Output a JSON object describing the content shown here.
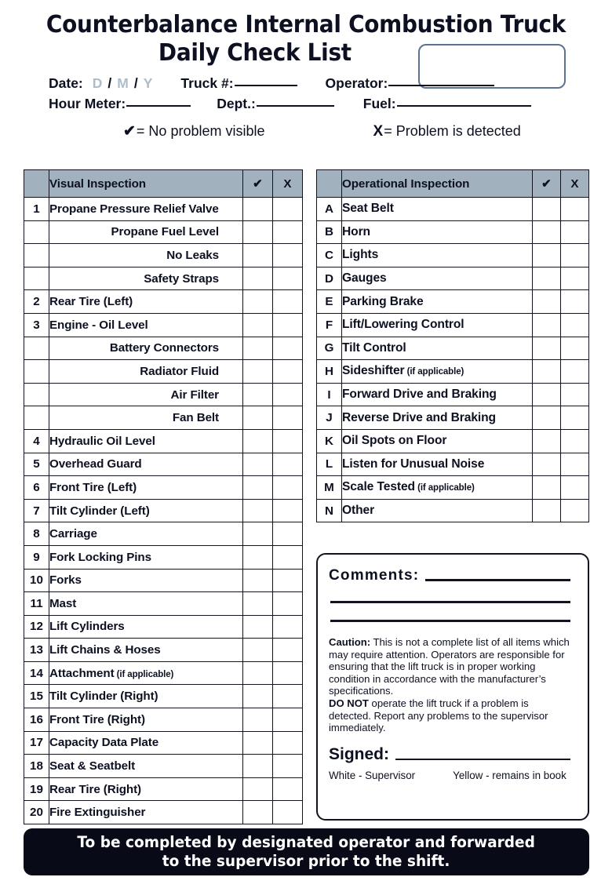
{
  "title": {
    "line1": "Counterbalance Internal Combustion Truck",
    "line2": "Daily Check List"
  },
  "header": {
    "date_label": "Date:",
    "date_day": "D",
    "date_month": "M",
    "date_year": "Y",
    "slash": "/",
    "truck_label": "Truck #:",
    "operator_label": "Operator:",
    "hour_meter_label": "Hour Meter:",
    "dept_label": "Dept.:",
    "fuel_label": "Fuel:"
  },
  "legend": {
    "check_mark": "✔",
    "check_text": "= No problem visible",
    "x_mark": "X",
    "x_text": "= Problem is detected"
  },
  "visual": {
    "header": {
      "title": "Visual Inspection",
      "check": "✔",
      "x": "X"
    },
    "rows": [
      {
        "num": "1",
        "label": "Propane Pressure Relief Valve",
        "sub": false
      },
      {
        "num": "",
        "label": "Propane Fuel Level",
        "sub": true
      },
      {
        "num": "",
        "label": "No Leaks",
        "sub": true
      },
      {
        "num": "",
        "label": "Safety Straps",
        "sub": true
      },
      {
        "num": "2",
        "label": "Rear Tire (Left)",
        "sub": false
      },
      {
        "num": "3",
        "label": "Engine - Oil Level",
        "sub": false
      },
      {
        "num": "",
        "label": "Battery Connectors",
        "sub": true
      },
      {
        "num": "",
        "label": "Radiator Fluid",
        "sub": true
      },
      {
        "num": "",
        "label": "Air Filter",
        "sub": true
      },
      {
        "num": "",
        "label": "Fan Belt",
        "sub": true
      },
      {
        "num": "4",
        "label": "Hydraulic Oil Level",
        "sub": false
      },
      {
        "num": "5",
        "label": "Overhead Guard",
        "sub": false
      },
      {
        "num": "6",
        "label": "Front Tire (Left)",
        "sub": false
      },
      {
        "num": "7",
        "label": "Tilt Cylinder (Left)",
        "sub": false
      },
      {
        "num": "8",
        "label": "Carriage",
        "sub": false
      },
      {
        "num": "9",
        "label": "Fork Locking Pins",
        "sub": false
      },
      {
        "num": "10",
        "label": "Forks",
        "sub": false
      },
      {
        "num": "11",
        "label": "Mast",
        "sub": false
      },
      {
        "num": "12",
        "label": "Lift Cylinders",
        "sub": false
      },
      {
        "num": "13",
        "label": "Lift Chains & Hoses",
        "sub": false
      },
      {
        "num": "14",
        "label": "Attachment",
        "note": "(if applicable)",
        "sub": false
      },
      {
        "num": "15",
        "label": "Tilt Cylinder (Right)",
        "sub": false
      },
      {
        "num": "16",
        "label": "Front Tire (Right)",
        "sub": false
      },
      {
        "num": "17",
        "label": "Capacity Data Plate",
        "sub": false
      },
      {
        "num": "18",
        "label": "Seat & Seatbelt",
        "sub": false
      },
      {
        "num": "19",
        "label": "Rear Tire (Right)",
        "sub": false
      },
      {
        "num": "20",
        "label": "Fire Extinguisher",
        "sub": false
      }
    ]
  },
  "operational": {
    "header": {
      "title": "Operational Inspection",
      "check": "✔",
      "x": "X"
    },
    "rows": [
      {
        "num": "A",
        "label": "Seat Belt"
      },
      {
        "num": "B",
        "label": "Horn"
      },
      {
        "num": "C",
        "label": "Lights"
      },
      {
        "num": "D",
        "label": "Gauges"
      },
      {
        "num": "E",
        "label": "Parking Brake"
      },
      {
        "num": "F",
        "label": "Lift/Lowering Control"
      },
      {
        "num": "G",
        "label": "Tilt Control"
      },
      {
        "num": "H",
        "label": "Sideshifter",
        "note": "(if applicable)"
      },
      {
        "num": "I",
        "label": "Forward Drive and Braking"
      },
      {
        "num": "J",
        "label": "Reverse Drive and Braking"
      },
      {
        "num": "K",
        "label": "Oil Spots on Floor"
      },
      {
        "num": "L",
        "label": "Listen for Unusual Noise"
      },
      {
        "num": "M",
        "label": "Scale Tested",
        "note": "(if applicable)"
      },
      {
        "num": "N",
        "label": "Other"
      }
    ]
  },
  "comments": {
    "label": "Comments:",
    "caution_bold": "Caution:",
    "caution_text": " This is not a complete list of all items which may require attention. Operators are responsible for ensuring that the lift truck is in proper working condition in accordance with the manufacturer’s specifications.",
    "donot_bold": "DO NOT",
    "donot_text": " operate the lift truck if a problem is detected. Report any problems to the supervisor immediately.",
    "signed_label": "Signed:",
    "copy_white": "White - Supervisor",
    "copy_yellow": "Yellow - remains in book"
  },
  "footer": {
    "line1": "To be completed by designated operator and forwarded",
    "line2": "to the supervisor prior to the shift."
  },
  "colors": {
    "header_gray": "#a2b1be",
    "ink": "#0d1020",
    "footer_bg": "#080a18",
    "corner_box_border": "#5b7391",
    "dmy_gray": "#aebdcb"
  }
}
